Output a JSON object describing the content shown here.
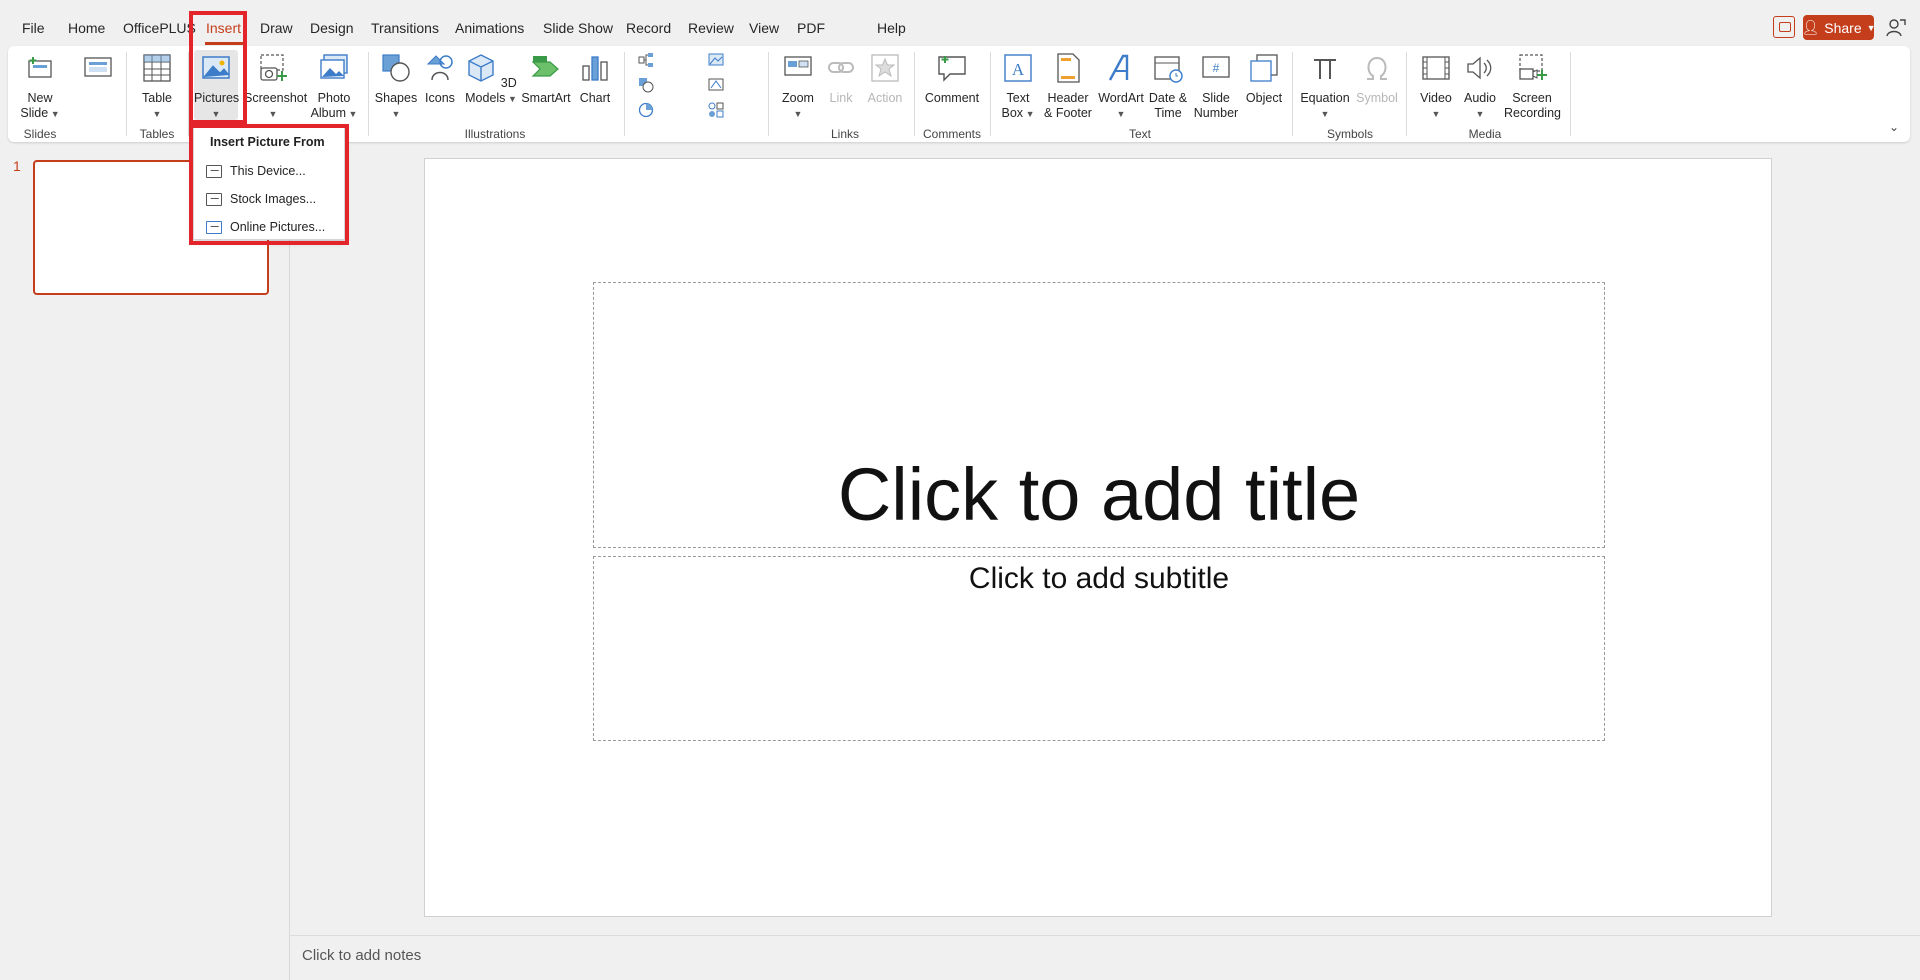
{
  "menu": {
    "tabs": [
      "File",
      "Home",
      "OfficePLUS",
      "Insert",
      "Draw",
      "Design",
      "Transitions",
      "Animations",
      "Slide Show",
      "Record",
      "Review",
      "View",
      "PDF",
      "Help"
    ],
    "active_tab": "Insert",
    "share_label": "Share"
  },
  "ribbon": {
    "new_slide": "New Slide",
    "table": "Table",
    "pictures": "Pictures",
    "screenshot": "Screenshot",
    "photo_album": "Photo Album",
    "shapes": "Shapes",
    "icons": "Icons",
    "models3d": "3D Models",
    "smartart": "SmartArt",
    "chart": "Chart",
    "zoom": "Zoom",
    "link": "Link",
    "action": "Action",
    "comment": "Comment",
    "text_box": "Text Box",
    "header_footer": "Header & Footer",
    "wordart": "WordArt",
    "date_time": "Date & Time",
    "slide_number": "Slide Number",
    "object": "Object",
    "equation": "Equation",
    "symbol": "Symbol",
    "video": "Video",
    "audio": "Audio",
    "screen_recording": "Screen Recording",
    "groups": {
      "slides": "Slides",
      "tables": "Tables",
      "illustrations": "Illustrations",
      "links": "Links",
      "comments": "Comments",
      "text": "Text",
      "symbols": "Symbols",
      "media": "Media"
    }
  },
  "dropdown": {
    "header": "Insert Picture From",
    "items": [
      "This Device...",
      "Stock Images...",
      "Online Pictures..."
    ]
  },
  "slides": {
    "number": "1"
  },
  "slide": {
    "title_placeholder": "Click to add title",
    "subtitle_placeholder": "Click to add subtitle"
  },
  "notes": {
    "placeholder": "Click to add notes"
  },
  "colors": {
    "accent": "#c43e1c",
    "highlight": "#e3242b"
  }
}
